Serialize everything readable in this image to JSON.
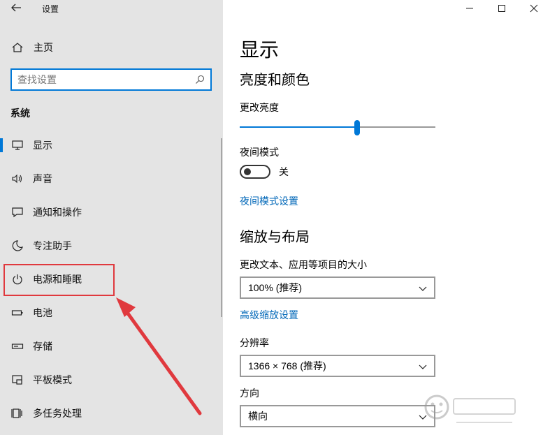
{
  "window": {
    "title": "设置",
    "controls": [
      "minimize",
      "maximize",
      "close"
    ]
  },
  "sidebar": {
    "home_label": "主页",
    "search": {
      "placeholder": "查找设置",
      "value": ""
    },
    "section_label": "系统",
    "items": [
      {
        "label": "显示",
        "icon": "monitor-icon",
        "active": true
      },
      {
        "label": "声音",
        "icon": "speaker-icon",
        "active": false
      },
      {
        "label": "通知和操作",
        "icon": "notification-icon",
        "active": false
      },
      {
        "label": "专注助手",
        "icon": "moon-icon",
        "active": false
      },
      {
        "label": "电源和睡眠",
        "icon": "power-icon",
        "active": false
      },
      {
        "label": "电池",
        "icon": "battery-icon",
        "active": false
      },
      {
        "label": "存储",
        "icon": "storage-icon",
        "active": false
      },
      {
        "label": "平板模式",
        "icon": "tablet-mode-icon",
        "active": false
      },
      {
        "label": "多任务处理",
        "icon": "multitask-icon",
        "active": false
      }
    ]
  },
  "main": {
    "page_title": "显示",
    "brightness_section": {
      "heading": "亮度和颜色",
      "brightness_label": "更改亮度",
      "brightness_value": 0.6,
      "night_mode_label": "夜间模式",
      "night_mode_state": "关",
      "night_mode_link": "夜间模式设置"
    },
    "scale_section": {
      "heading": "缩放与布局",
      "size_label": "更改文本、应用等项目的大小",
      "size_value": "100% (推荐)",
      "advanced_link": "高级缩放设置",
      "resolution_label": "分辨率",
      "resolution_value": "1366 × 768 (推荐)",
      "orientation_label": "方向",
      "orientation_value": "横向"
    }
  },
  "colors": {
    "accent": "#0078d7",
    "link": "#0067b8",
    "sidebar_bg": "#e4e4e4",
    "annotation": "#e0393e"
  }
}
